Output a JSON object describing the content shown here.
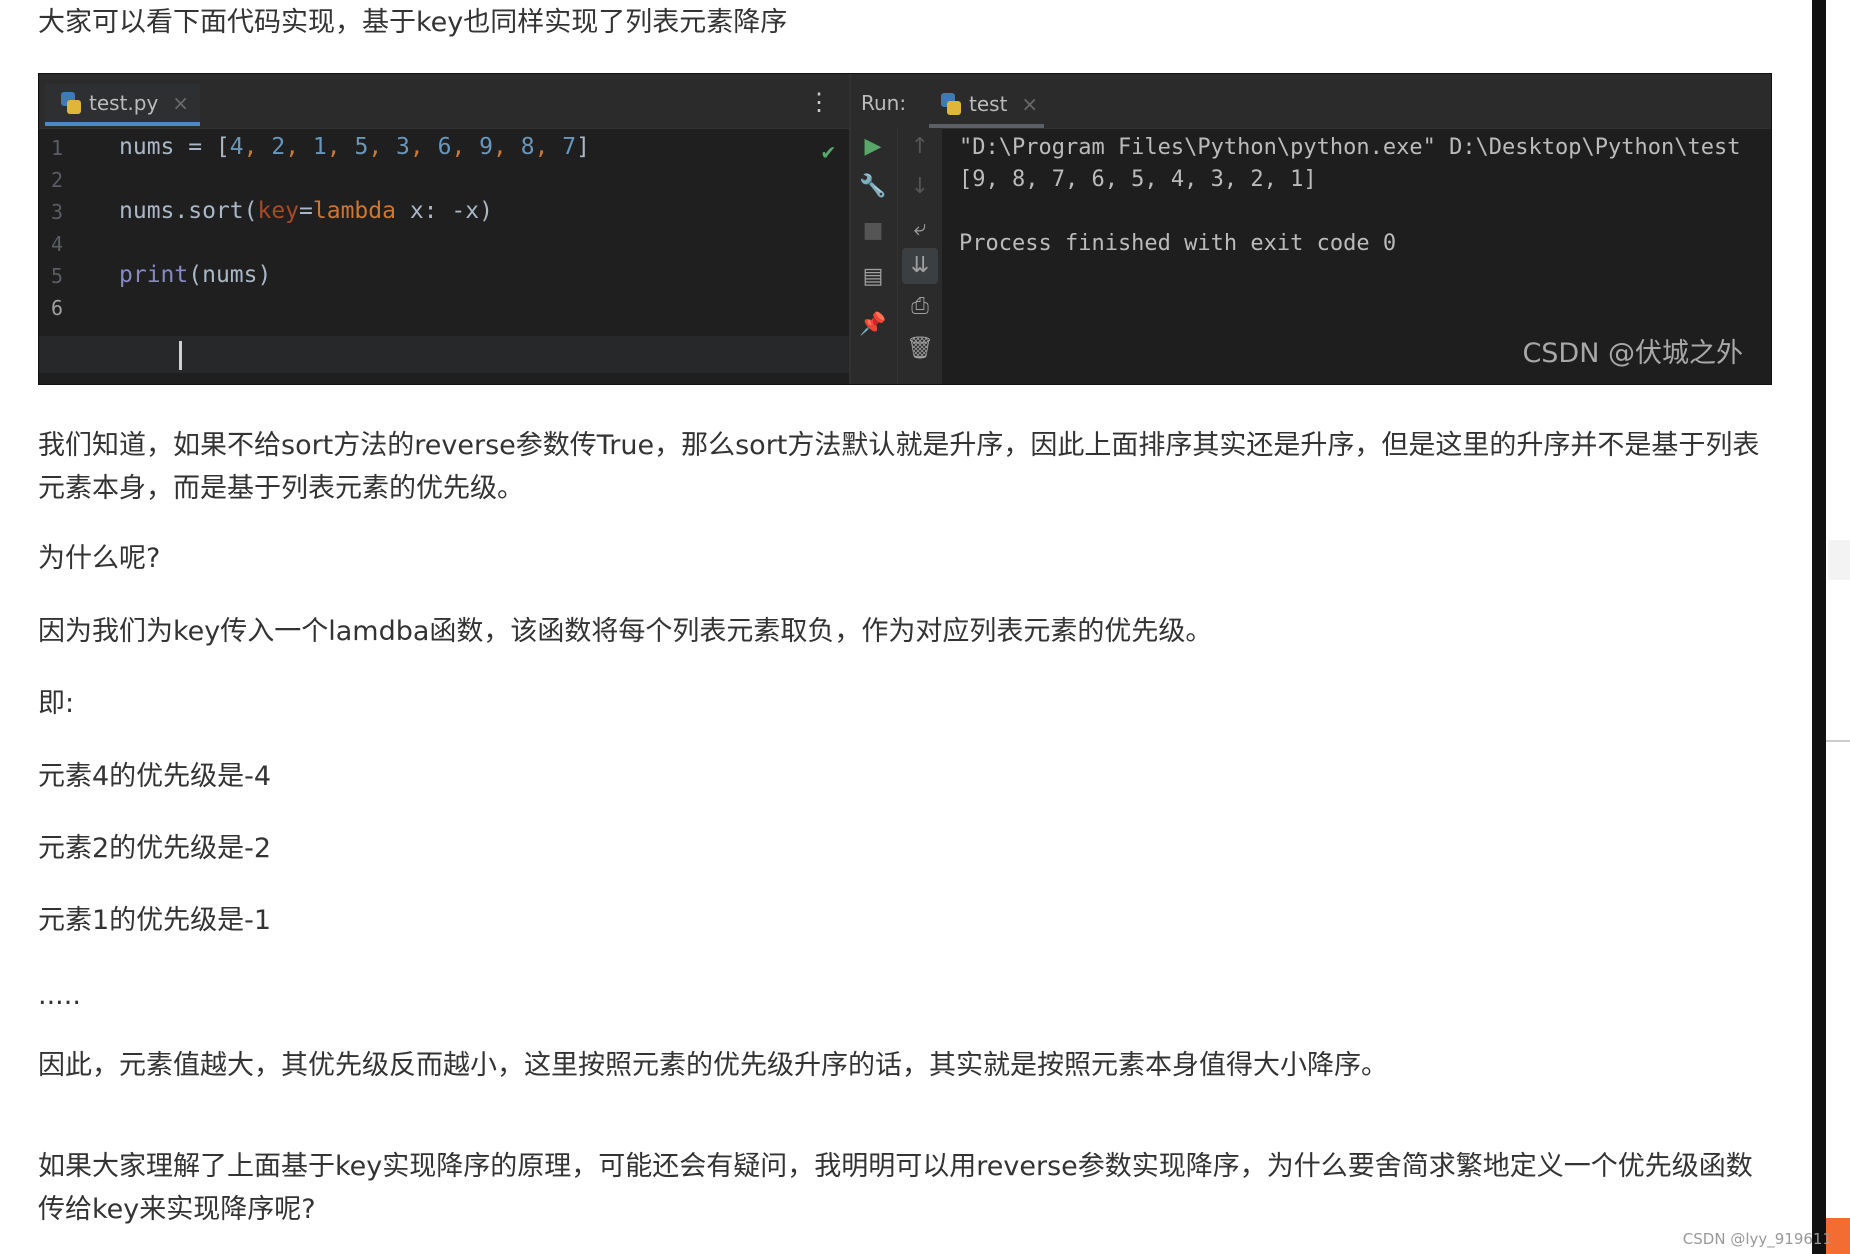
{
  "article": {
    "intro": "大家可以看下面代码实现，基于key也同样实现了列表元素降序",
    "paragraphs": [
      "我们知道，如果不给sort方法的reverse参数传True，那么sort方法默认就是升序，因此上面排序其实还是升序，但是这里的升序并不是基于列表元素本身，而是基于列表元素的优先级。",
      "为什么呢?",
      "因为我们为key传入一个lamdba函数，该函数将每个列表元素取负，作为对应列表元素的优先级。",
      "即:",
      "元素4的优先级是-4",
      "元素2的优先级是-2",
      "元素1的优先级是-1",
      ".....",
      "因此，元素值越大，其优先级反而越小，这里按照元素的优先级升序的话，其实就是按照元素本身值得大小降序。",
      "如果大家理解了上面基于key实现降序的原理，可能还会有疑问，我明明可以用reverse参数实现降序，为什么要舍简求繁地定义一个优先级函数传给key来实现降序呢?"
    ]
  },
  "ide": {
    "editor_tab": "test.py",
    "line_numbers": [
      "1",
      "2",
      "3",
      "4",
      "5",
      "6"
    ],
    "code": {
      "line1": {
        "a": "nums = [",
        "n": [
          "4",
          "2",
          "1",
          "5",
          "3",
          "6",
          "9",
          "8",
          "7"
        ],
        "b": "]"
      },
      "line3": {
        "a": "nums.sort(",
        "param": "key",
        "eq": "=",
        "kw": "lambda",
        "rest": " x: -x)"
      },
      "line5": {
        "fn": "print",
        "rest": "(nums)"
      }
    },
    "run_label": "Run:",
    "run_tab": "test",
    "console": [
      "\"D:\\Program Files\\Python\\python.exe\" D:\\Desktop\\Python\\test",
      "[9, 8, 7, 6, 5, 4, 3, 2, 1]",
      "",
      "Process finished with exit code 0"
    ],
    "watermark": "CSDN @伏城之外"
  },
  "footer_watermark": "CSDN @lyy_919611",
  "colors": {
    "ide_bg": "#1e1f22",
    "number": "#6897bb",
    "keyword": "#cc7832",
    "check": "#59a869",
    "accent_orange": "#f36c32"
  },
  "icons": [
    "python-file-icon",
    "close-icon",
    "more-vert-icon",
    "check-icon",
    "play-icon",
    "wrench-icon",
    "stop-icon",
    "layout-icon",
    "pin-icon",
    "arrow-up-icon",
    "arrow-down-icon",
    "soft-wrap-icon",
    "scroll-end-icon",
    "print-icon",
    "trash-icon"
  ]
}
